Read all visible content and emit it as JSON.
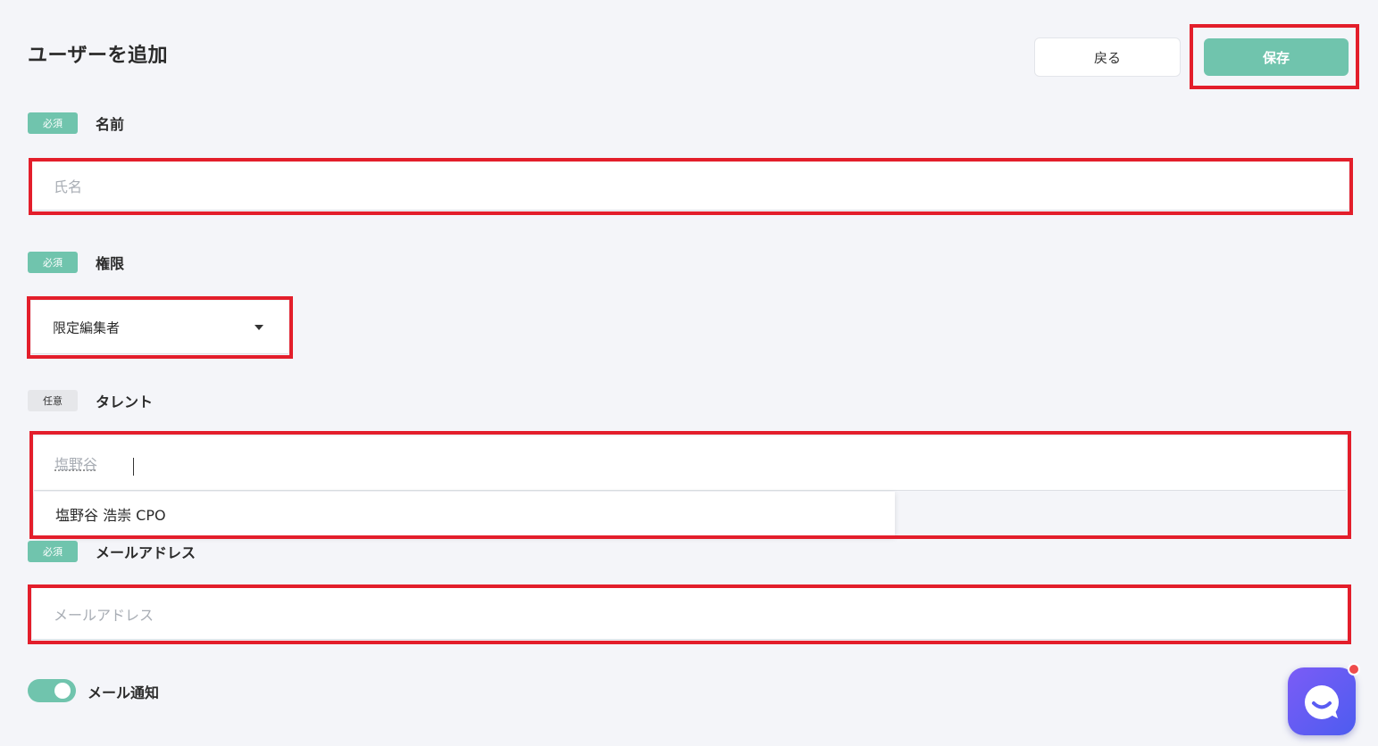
{
  "header": {
    "title": "ユーザーを追加",
    "back_label": "戻る",
    "save_label": "保存"
  },
  "badges": {
    "required": "必須",
    "optional": "任意"
  },
  "fields": {
    "name": {
      "label": "名前",
      "placeholder": "氏名",
      "value": ""
    },
    "role": {
      "label": "権限",
      "selected": "限定編集者"
    },
    "talent": {
      "label": "タレント",
      "typed_value": "塩野谷",
      "suggestions": [
        "塩野谷 浩崇 CPO"
      ]
    },
    "email": {
      "label": "メールアドレス",
      "placeholder": "メールアドレス",
      "value": ""
    }
  },
  "notification": {
    "label": "メール通知",
    "enabled": true
  },
  "colors": {
    "accent": "#70c4ad",
    "highlight": "#e31e2b",
    "background": "#f4f5f9",
    "chat": "#6a5cf3",
    "chat_badge": "#ef4c4c"
  },
  "icons": {
    "role_dropdown": "caret-down-icon",
    "chat_launcher": "chat-bubble-icon"
  }
}
